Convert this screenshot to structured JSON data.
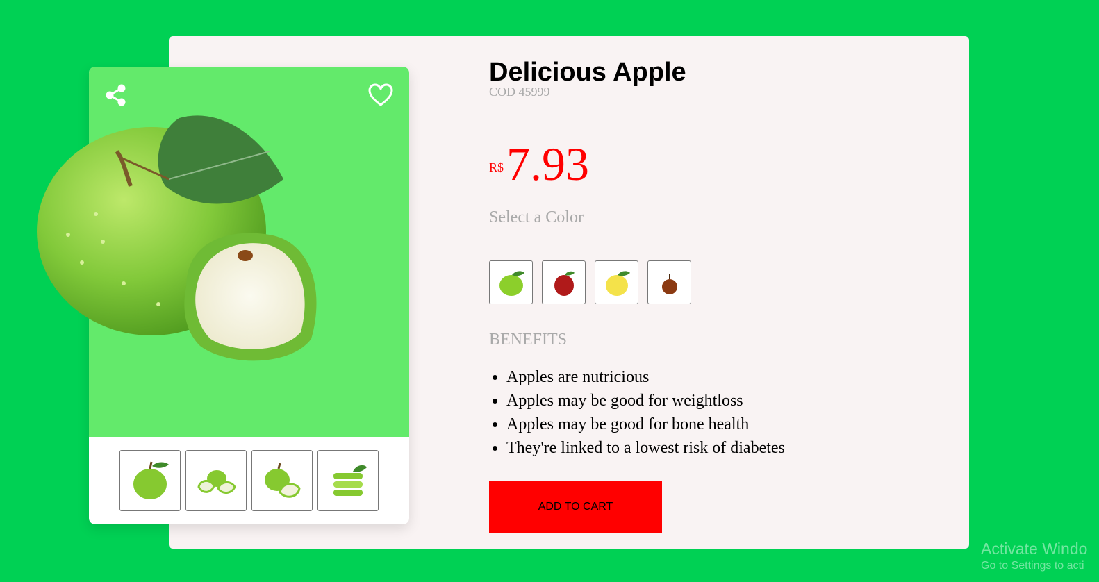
{
  "product": {
    "title": "Delicious Apple",
    "code": "COD 45999",
    "currency": "R$",
    "price": "7.93",
    "select_color_label": "Select a Color",
    "benefits_label": "BENEFITS",
    "benefits": [
      "Apples are nutricious",
      "Apples may be good for weightloss",
      "Apples may be good for bone health",
      "They're linked to a lowest risk of diabetes"
    ],
    "add_to_cart_label": "ADD TO CART"
  },
  "gallery": {
    "icons": {
      "share": "share-icon",
      "favorite": "heart-icon"
    },
    "hero": "green-apple-with-slice",
    "thumbnails": [
      "green-apple",
      "apple-slices",
      "apple-with-slice",
      "sliced-apple-stack"
    ]
  },
  "colors": [
    {
      "name": "green",
      "hex": "#8ccf2b"
    },
    {
      "name": "red",
      "hex": "#b01a1a"
    },
    {
      "name": "yellow",
      "hex": "#f4e24a"
    },
    {
      "name": "brown",
      "hex": "#8b3a12"
    }
  ],
  "watermark": {
    "title": "Activate Windo",
    "subtitle": "Go to Settings to acti"
  },
  "theme": {
    "background": "#00d154",
    "panel": "#f9f3f3",
    "hero": "#63ea6b",
    "accent": "#ff0000"
  }
}
